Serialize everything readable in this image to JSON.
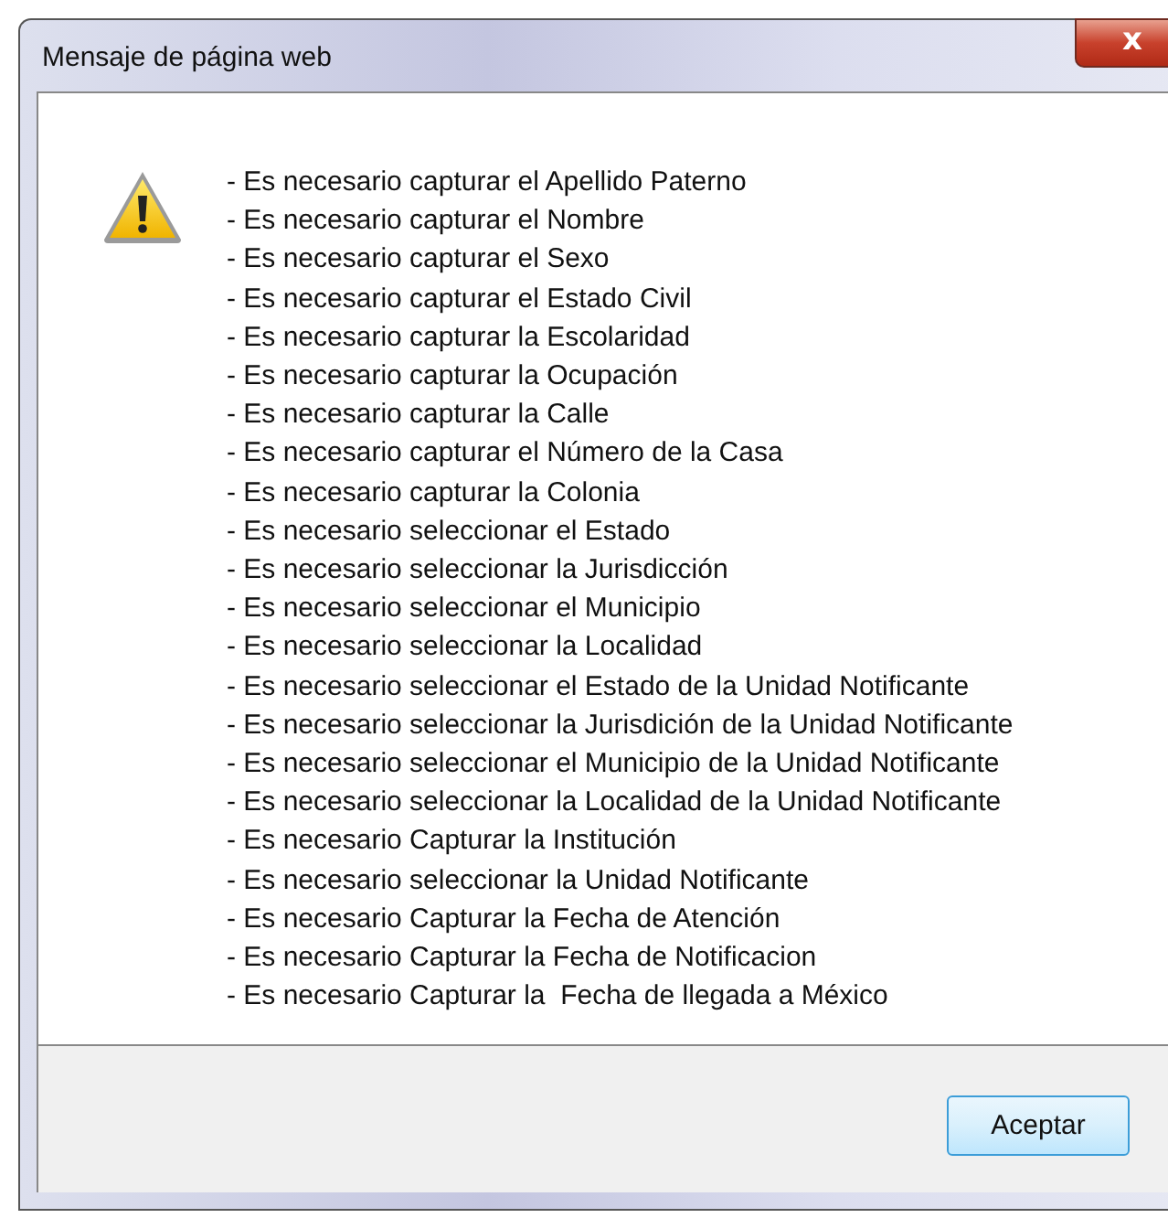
{
  "window": {
    "title": "Mensaje de página web",
    "close": "x"
  },
  "message": {
    "lines": [
      "- Es necesario capturar el Apellido Paterno",
      "- Es necesario capturar el Nombre",
      "- Es necesario capturar el Sexo",
      "- Es necesario capturar el Estado Civil",
      "- Es necesario capturar la Escolaridad",
      "- Es necesario capturar la Ocupación",
      "- Es necesario capturar la Calle",
      "- Es necesario capturar el Número de la Casa",
      "- Es necesario capturar la Colonia",
      "- Es necesario seleccionar el Estado",
      "- Es necesario seleccionar la Jurisdicción",
      "- Es necesario seleccionar el Municipio",
      "- Es necesario seleccionar la Localidad",
      "- Es necesario seleccionar el Estado de la Unidad Notificante",
      "- Es necesario seleccionar la Jurisdición de la Unidad Notificante",
      "- Es necesario seleccionar el Municipio de la Unidad Notificante",
      "- Es necesario seleccionar la Localidad de la Unidad Notificante",
      "- Es necesario Capturar la Institución",
      "- Es necesario seleccionar la Unidad Notificante",
      "- Es necesario Capturar la Fecha de Atención",
      "- Es necesario Capturar la Fecha de Notificacion",
      "- Es necesario Capturar la  Fecha de llegada a México"
    ]
  },
  "buttons": [
    "Aceptar"
  ]
}
